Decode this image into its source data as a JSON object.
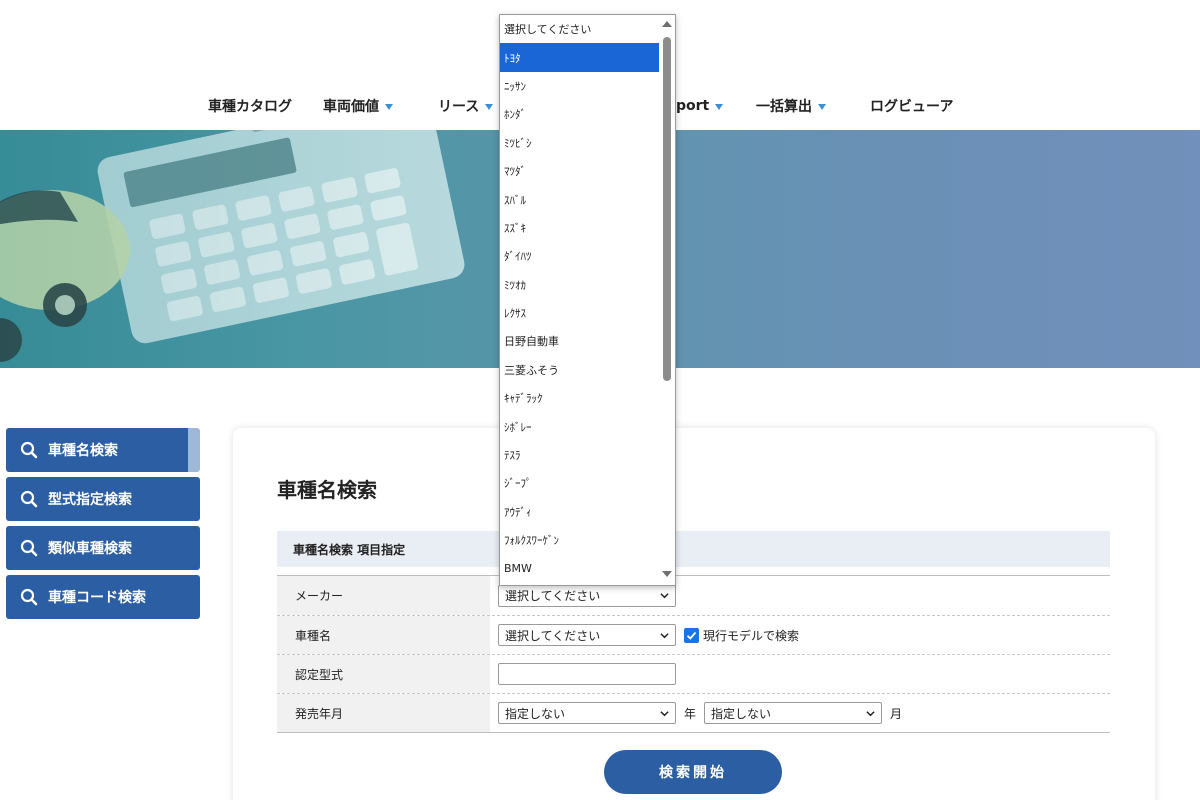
{
  "nav": {
    "items": [
      {
        "label": "車種カタログ",
        "caret": false
      },
      {
        "label": "車両価値",
        "caret": true
      },
      {
        "label": "リース",
        "caret": true
      },
      {
        "label": "port",
        "caret": true
      },
      {
        "label": "一括算出",
        "caret": true
      },
      {
        "label": "ログビューア",
        "caret": false
      }
    ]
  },
  "sidebar": {
    "items": [
      {
        "label": "車種名検索",
        "active": true
      },
      {
        "label": "型式指定検索",
        "active": false
      },
      {
        "label": "類似車種検索",
        "active": false
      },
      {
        "label": "車種コード検索",
        "active": false
      }
    ]
  },
  "main": {
    "title": "車種名検索",
    "section_header": "車種名検索 項目指定",
    "rows": {
      "maker": {
        "label": "メーカー",
        "value": "選択してください"
      },
      "model": {
        "label": "車種名",
        "value": "選択してください",
        "checkbox_label": "現行モデルで検索",
        "checked": true
      },
      "cert": {
        "label": "認定型式",
        "value": ""
      },
      "release": {
        "label": "発売年月",
        "year_value": "指定しない",
        "year_unit": "年",
        "month_value": "指定しない",
        "month_unit": "月"
      }
    },
    "search_button": "検索開始"
  },
  "dropdown": {
    "selected_index": 1,
    "options": [
      "選択してください",
      "ﾄﾖﾀ",
      "ﾆｯｻﾝ",
      "ﾎﾝﾀﾞ",
      "ﾐﾂﾋﾞｼ",
      "ﾏﾂﾀﾞ",
      "ｽﾊﾞﾙ",
      "ｽｽﾞｷ",
      "ﾀﾞｲﾊﾂ",
      "ﾐﾂｵｶ",
      "ﾚｸｻｽ",
      "日野自動車",
      "三菱ふそう",
      "ｷｬﾃﾞﾗｯｸ",
      "ｼﾎﾞﾚｰ",
      "ﾃｽﾗ",
      "ｼﾞｰﾌﾟ",
      "ｱｳﾃﾞｨ",
      "ﾌｫﾙｸｽﾜｰｹﾞﾝ",
      "BMW"
    ]
  },
  "colors": {
    "primary": "#2c5ea3",
    "selected_option": "#1a66d6",
    "checkbox": "#1a73e8"
  }
}
